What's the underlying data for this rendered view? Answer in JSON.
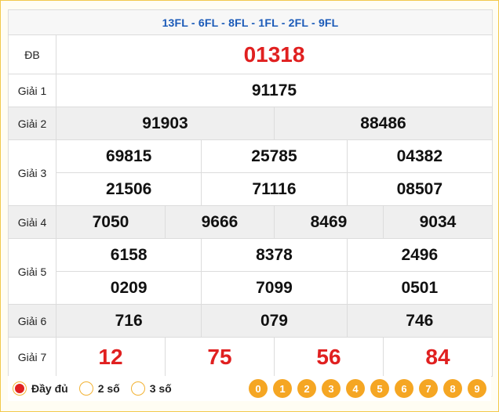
{
  "header": {
    "codes": "13FL - 6FL - 8FL - 1FL - 2FL - 9FL"
  },
  "prizes": {
    "db": {
      "label": "ĐB",
      "values": [
        "01318"
      ]
    },
    "g1": {
      "label": "Giải 1",
      "values": [
        "91175"
      ]
    },
    "g2": {
      "label": "Giải 2",
      "values": [
        "91903",
        "88486"
      ]
    },
    "g3": {
      "label": "Giải 3",
      "values": [
        "69815",
        "25785",
        "04382",
        "21506",
        "71116",
        "08507"
      ]
    },
    "g4": {
      "label": "Giải 4",
      "values": [
        "7050",
        "9666",
        "8469",
        "9034"
      ]
    },
    "g5": {
      "label": "Giải 5",
      "values": [
        "6158",
        "8378",
        "2496",
        "0209",
        "7099",
        "0501"
      ]
    },
    "g6": {
      "label": "Giải 6",
      "values": [
        "716",
        "079",
        "746"
      ]
    },
    "g7": {
      "label": "Giải 7",
      "values": [
        "12",
        "75",
        "56",
        "84"
      ]
    }
  },
  "footer": {
    "options": [
      "Đầy đủ",
      "2 số",
      "3 số"
    ],
    "selected": "Đầy đủ",
    "digits": [
      "0",
      "1",
      "2",
      "3",
      "4",
      "5",
      "6",
      "7",
      "8",
      "9"
    ]
  },
  "colors": {
    "accent": "#e02020",
    "header_text": "#1a5ab8",
    "digit_bg": "#f5a623"
  }
}
